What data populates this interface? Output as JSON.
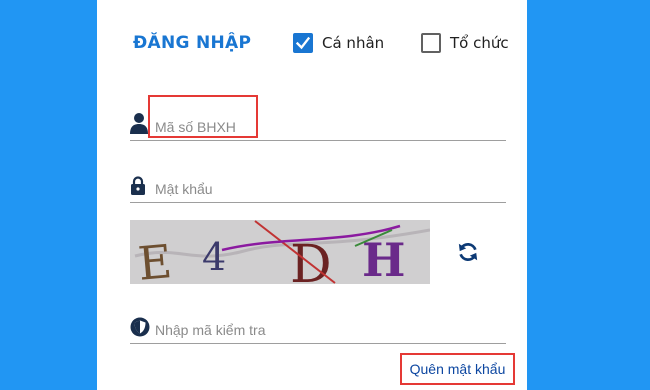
{
  "login": {
    "title": "ĐĂNG NHẬP",
    "account_types": [
      {
        "label": "Cá nhân",
        "checked": true
      },
      {
        "label": "Tổ chức",
        "checked": false
      }
    ],
    "username": {
      "placeholder": "Mã số BHXH",
      "value": ""
    },
    "password": {
      "placeholder": "Mật khẩu",
      "value": ""
    },
    "captcha": {
      "text": "E4DH",
      "placeholder": "Nhập mã kiểm tra",
      "value": ""
    },
    "forgot_password_label": "Quên mật khẩu"
  },
  "colors": {
    "background": "#2196f3",
    "panel": "#ffffff",
    "accent": "#1976d2",
    "highlight": "#e53935",
    "link": "#0d47a1"
  },
  "icons": {
    "username": "person-icon",
    "password": "lock-icon",
    "captcha_input": "shield-icon",
    "refresh": "refresh-icon",
    "checkbox_checked": "check-icon"
  }
}
